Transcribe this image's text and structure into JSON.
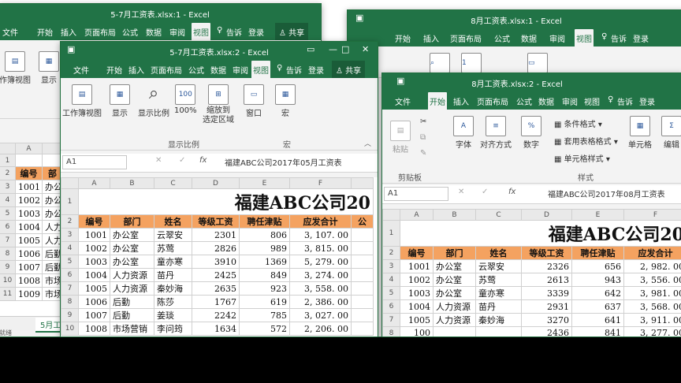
{
  "colors": {
    "accent": "#217346",
    "header_fill": "#f4a260"
  },
  "win1": {
    "title": "5-7月工资表.xlsx:1 - Excel",
    "menu": [
      "文件",
      "开始",
      "插入",
      "页面布局",
      "公式",
      "数据",
      "审阅",
      "视图"
    ],
    "tell": "告诉",
    "login": "登录",
    "share": "共享",
    "ribbon": [
      "作簿视图",
      "显示"
    ],
    "col": "A",
    "cells_a": [
      "编号",
      "1001",
      "1002",
      "1003",
      "1004",
      "1005",
      "1006",
      "1007",
      "1008",
      "1009"
    ],
    "cells_b": [
      "部",
      "办公",
      "办公",
      "办公",
      "人力",
      "人力",
      "后勤",
      "后勤",
      "市场",
      "市场"
    ],
    "tab": "5月工",
    "status": "就绪"
  },
  "win2": {
    "title": "8月工资表.xlsx:1 - Excel",
    "menu": [
      "开始",
      "插入",
      "页面布局",
      "公式",
      "数据",
      "审阅",
      "视图"
    ],
    "tell": "告诉",
    "login": "登录"
  },
  "win3": {
    "title": "5-7月工资表.xlsx:2 - Excel",
    "menu": [
      "文件",
      "开始",
      "插入",
      "页面布局",
      "公式",
      "数据",
      "审阅",
      "视图"
    ],
    "tell": "告诉",
    "login": "登录",
    "share": "共享",
    "ribbon": {
      "workbook_view": "工作簿视图",
      "show": "显示",
      "zoom": "显示比例",
      "zoom100": "100%",
      "zoom_sel": "缩放到\n选定区域",
      "window": "窗口",
      "macro": "宏",
      "group_zoom": "显示比例",
      "group_macro": "宏"
    },
    "namebox": "A1",
    "fx": "fx",
    "formula": "福建ABC公司2017年05月工资表",
    "cols": [
      "A",
      "B",
      "C",
      "D",
      "E",
      "F",
      ""
    ],
    "title_text": "福建ABC公司20",
    "headers": [
      "编号",
      "部门",
      "姓名",
      "等级工资",
      "聘任津贴",
      "应发合计",
      "公"
    ],
    "rows": [
      [
        "1001",
        "办公室",
        "云翠安",
        "2301",
        "806",
        "3, 107. 00"
      ],
      [
        "1002",
        "办公室",
        "苏莺",
        "2826",
        "989",
        "3, 815. 00"
      ],
      [
        "1003",
        "办公室",
        "童亦寒",
        "3910",
        "1369",
        "5, 279. 00"
      ],
      [
        "1004",
        "人力资源",
        "苗丹",
        "2425",
        "849",
        "3, 274. 00"
      ],
      [
        "1005",
        "人力资源",
        "秦妙海",
        "2635",
        "923",
        "3, 558. 00"
      ],
      [
        "1006",
        "后勤",
        "陈莎",
        "1767",
        "619",
        "2, 386. 00"
      ],
      [
        "1007",
        "后勤",
        "姜琰",
        "2242",
        "785",
        "3, 027. 00"
      ],
      [
        "1008",
        "市场营销",
        "李问筠",
        "1634",
        "572",
        "2, 206. 00"
      ]
    ]
  },
  "win4": {
    "title": "8月工资表.xlsx:2 - Excel",
    "menu": [
      "文件",
      "开始",
      "插入",
      "页面布局",
      "公式",
      "数据",
      "审阅",
      "视图"
    ],
    "tell": "告诉",
    "login": "登录",
    "ribbon": {
      "paste": "粘贴",
      "font": "字体",
      "align": "对齐方式",
      "number": "数字",
      "cond": "条件格式",
      "table": "套用表格格式",
      "cellstyle": "单元格样式",
      "cells": "单元格",
      "edit": "编辑",
      "group_clip": "剪贴板",
      "group_style": "样式"
    },
    "namebox": "A1",
    "fx": "fx",
    "formula": "福建ABC公司2017年08月工资表",
    "cols": [
      "A",
      "B",
      "C",
      "D",
      "E",
      "F"
    ],
    "title_text": "福建ABC公司20",
    "headers": [
      "编号",
      "部门",
      "姓名",
      "等级工资",
      "聘任津贴",
      "应发合计"
    ],
    "rows": [
      [
        "1001",
        "办公室",
        "云翠安",
        "2326",
        "656",
        "2, 982. 00"
      ],
      [
        "1002",
        "办公室",
        "苏莺",
        "2613",
        "943",
        "3, 556. 00"
      ],
      [
        "1003",
        "办公室",
        "童亦寒",
        "3339",
        "642",
        "3, 981. 00"
      ],
      [
        "1004",
        "人力资源",
        "苗丹",
        "2931",
        "637",
        "3, 568. 00"
      ],
      [
        "1005",
        "人力资源",
        "秦妙海",
        "3270",
        "641",
        "3, 911. 00"
      ],
      [
        "100",
        "",
        "",
        "2436",
        "841",
        "3, 277. 00"
      ]
    ]
  }
}
